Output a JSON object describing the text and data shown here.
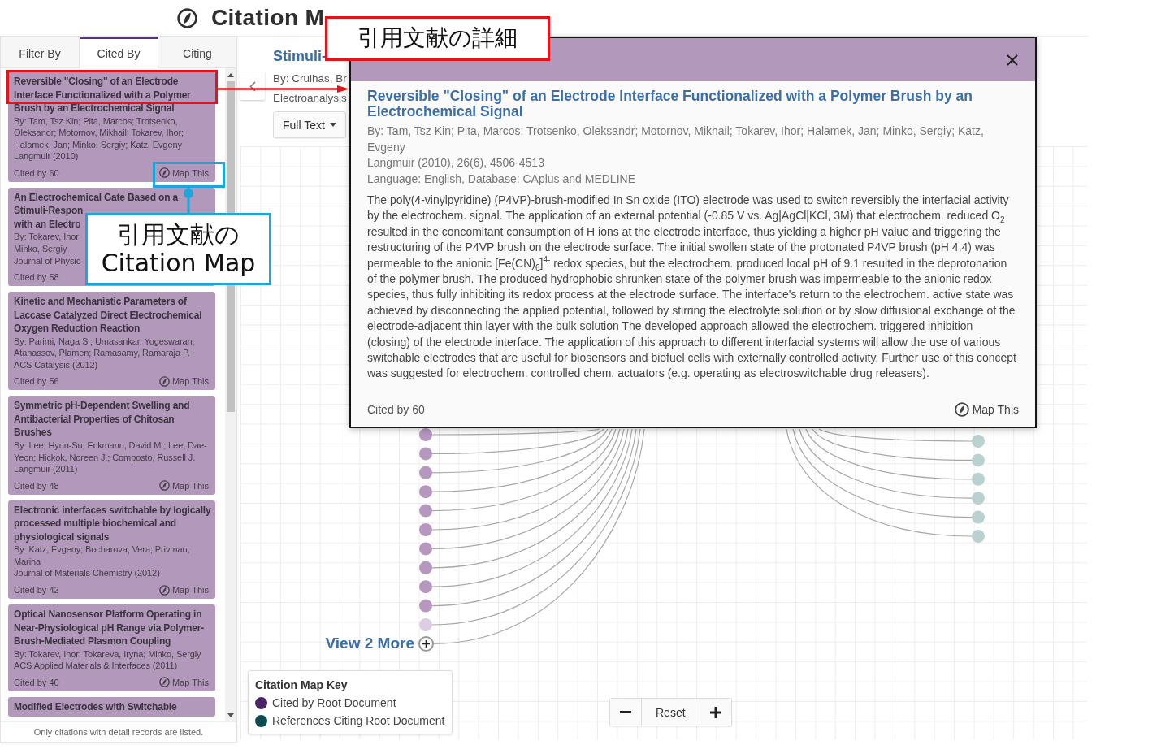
{
  "header": {
    "title": "Citation M"
  },
  "sidebar": {
    "tabs": [
      {
        "label": "Filter By",
        "selected": false
      },
      {
        "label": "Cited By",
        "selected": true
      },
      {
        "label": "Citing",
        "selected": false
      }
    ],
    "items": [
      {
        "kind": "full",
        "title": "Reversible \"Closing\" of an Electrode Interface Functionalized with a Polymer Brush by an Electrochemical Signal",
        "authors": "By: Tam, Tsz Kin; Pita, Marcos; Trotsenko, Oleksandr; Motornov, Mikhail; Tokarev, Ihor; Halamek, Jan; Minko, Sergiy; Katz, Evgeny",
        "source": "Langmuir (2010)",
        "cited_by": "Cited by 60",
        "map_link": "Map This"
      },
      {
        "kind": "covered",
        "title_lines": [
          "An Electrochemical Gate Based on a",
          "Stimuli-Respon",
          "with an Electro"
        ],
        "author_lines": [
          "By: Tokarev, Ihor",
          "Minko, Sergiy"
        ],
        "source": "Journal of Physic",
        "cited_by": "Cited by 58"
      },
      {
        "kind": "full",
        "title": "Kinetic and Mechanistic Parameters of Laccase Catalyzed Direct Electrochemical Oxygen Reduction Reaction",
        "authors": "By: Parimi, Naga S.; Umasankar, Yogeswaran; Atanassov, Plamen; Ramasamy, Ramaraja P.",
        "source": "ACS Catalysis (2012)",
        "cited_by": "Cited by 56",
        "map_link": "Map This"
      },
      {
        "kind": "full",
        "title": "Symmetric pH-Dependent Swelling and Antibacterial Properties of Chitosan Brushes",
        "authors": "By: Lee, Hyun-Su; Eckmann, David M.; Lee, Dae-Yeon; Hickok, Noreen J.; Composto, Russell J.",
        "source": "Langmuir (2011)",
        "cited_by": "Cited by 48",
        "map_link": "Map This"
      },
      {
        "kind": "full",
        "title": "Electronic interfaces switchable by logically processed multiple biochemical and physiological signals",
        "authors": "By: Katz, Evgeny; Bocharova, Vera; Privman, Marina",
        "source": "Journal of Materials Chemistry (2012)",
        "cited_by": "Cited by 42",
        "map_link": "Map This"
      },
      {
        "kind": "full",
        "title": "Optical Nanosensor Platform Operating in Near-Physiological pH Range via Polymer-Brush-Mediated Plasmon Coupling",
        "authors": "By: Tokarev, Ihor; Tokareva, Iryna; Minko, Sergiy",
        "source": "ACS Applied Materials & Interfaces (2011)",
        "cited_by": "Cited by 40",
        "map_link": "Map This"
      },
      {
        "kind": "cut",
        "title": "Modified Electrodes with Switchable"
      }
    ],
    "footer_note": "Only citations with detail records are listed."
  },
  "root_document": {
    "title": "Stimuli-",
    "authors": "By: Crulhas, Br",
    "source": "Electroanalysis",
    "full_text_button": "Full Text"
  },
  "citation_map": {
    "cited_nodes": [
      {
        "dimmed": false
      },
      {
        "dimmed": false
      },
      {
        "dimmed": false
      },
      {
        "dimmed": false
      },
      {
        "dimmed": false
      },
      {
        "dimmed": false
      },
      {
        "dimmed": false
      },
      {
        "dimmed": false
      },
      {
        "dimmed": false
      },
      {
        "dimmed": false
      },
      {
        "dimmed": true
      }
    ],
    "citing_nodes": [
      {
        "dimmed": false
      },
      {
        "dimmed": false
      },
      {
        "dimmed": false
      },
      {
        "dimmed": false
      },
      {
        "dimmed": false
      },
      {
        "dimmed": false
      }
    ],
    "more_link": "View 2 More",
    "legend": {
      "title": "Citation Map Key",
      "items": [
        {
          "label": "Cited by Root Document",
          "color": "#4b2467"
        },
        {
          "label": "References Citing Root Document",
          "color": "#0e4b50"
        }
      ]
    },
    "zoom_controls": {
      "reset": "Reset"
    }
  },
  "detail_popup": {
    "title": "Reversible \"Closing\" of an Electrode Interface Functionalized with a Polymer Brush by an Electrochemical Signal",
    "authors": "By: Tam, Tsz Kin; Pita, Marcos; Trotsenko, Oleksandr; Motornov, Mikhail; Tokarev, Ihor; Halamek, Jan; Minko, Sergiy; Katz, Evgeny",
    "citation": "Langmuir (2010), 26(6), 4506-4513",
    "language": "Language: English, Database: CAplus and MEDLINE",
    "abstract": "The poly(4-vinylpyridine) (P4VP)-brush-modified In Sn oxide (ITO) electrode was used to switch reversibly the interfacial activity by the electrochem. signal. The application of an external potential (-0.85 V vs. Ag|AgCl|KCl, 3M) that electrochem. reduced O$_{2}$ resulted in the concomitant consumption of H ions at the electrode interface, thus yielding a higher pH value and triggering the restructuring of the P4VP brush on the electrode surface. The initial swollen state of the protonated P4VP brush (pH 4.4) was permeable to the anionic [Fe(CN)$_{6}$]$^{4-}$ redox species, but the electrochem. produced local pH of 9.1 resulted in the deprotonation of the polymer brush. The produced hydrophobic shrunken state of the polymer brush was impermeable to the anionic redox species, thus fully inhibiting its redox process at the electrode surface. The interface's return to the electrochem. active state was achieved by disconnecting the applied potential, followed by stirring the electrolyte solution or by slow diffusional exchange of the electrode-adjacent thin layer with the bulk solution The developed approach allowed the electrochem. triggered inhibition (closing) of the electrode interface. The application of this approach to different interfacial systems will allow the use of various switchable electrodes that are useful for biosensors and biofuel cells with externally controlled activity. Further use of this concept was suggested for electrochem. controlled chem. actuators (e.g. operating as electroswitchable drug releasers).",
    "cited_by": "Cited by 60",
    "map_link": "Map This"
  },
  "annotations": [
    {
      "kind": "detail",
      "lines": [
        "引用文献の詳細"
      ],
      "color": "#e3121b"
    },
    {
      "kind": "map",
      "lines": [
        "引用文献の",
        "Citation Map"
      ],
      "color": "#1ea5dc"
    }
  ]
}
